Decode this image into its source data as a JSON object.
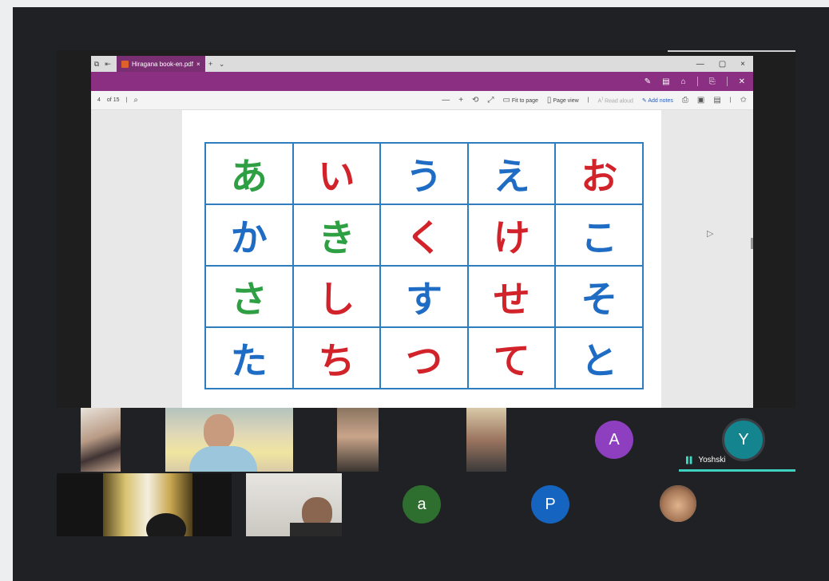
{
  "browser": {
    "tab_title": "Hiragana book-en.pdf",
    "tab_close": "×",
    "new_tab": "+",
    "tab_menu": "⌄",
    "window_controls": [
      "—",
      "▢",
      "×"
    ]
  },
  "pdf_toolbar": {
    "page_number": "4",
    "page_total": "of 15",
    "zoom_out": "—",
    "zoom_in": "+",
    "fit_to_page": "Fit to page",
    "page_view": "Page view",
    "read_aloud": "Read aloud",
    "add_notes": "Add notes"
  },
  "hiragana_rows": [
    [
      {
        "k": "あ",
        "c": "c-green"
      },
      {
        "k": "い",
        "c": "c-red"
      },
      {
        "k": "う",
        "c": "c-blue"
      },
      {
        "k": "え",
        "c": "c-blue"
      },
      {
        "k": "お",
        "c": "c-red"
      }
    ],
    [
      {
        "k": "か",
        "c": "c-blue"
      },
      {
        "k": "き",
        "c": "c-green"
      },
      {
        "k": "く",
        "c": "c-red"
      },
      {
        "k": "け",
        "c": "c-red"
      },
      {
        "k": "こ",
        "c": "c-blue"
      }
    ],
    [
      {
        "k": "さ",
        "c": "c-green"
      },
      {
        "k": "し",
        "c": "c-red"
      },
      {
        "k": "す",
        "c": "c-blue"
      },
      {
        "k": "せ",
        "c": "c-red"
      },
      {
        "k": "そ",
        "c": "c-blue"
      }
    ],
    [
      {
        "k": "た",
        "c": "c-blue"
      },
      {
        "k": "ち",
        "c": "c-red"
      },
      {
        "k": "つ",
        "c": "c-red"
      },
      {
        "k": "て",
        "c": "c-red"
      },
      {
        "k": "と",
        "c": "c-blue"
      }
    ]
  ],
  "participants": {
    "avatar_a_upper": "A",
    "avatar_y": "Y",
    "active_speaker_name": "Yoshski",
    "avatar_a_lower": "a",
    "avatar_p": "P"
  },
  "colors": {
    "pdf_accent": "#8b2f82",
    "grid_border": "#2d7dbf",
    "speaker_highlight": "#3fd1bf",
    "avatar_purple": "#8e3fbf",
    "avatar_teal": "#14858e",
    "avatar_green": "#2e6e2e",
    "avatar_blue": "#1565c0"
  }
}
